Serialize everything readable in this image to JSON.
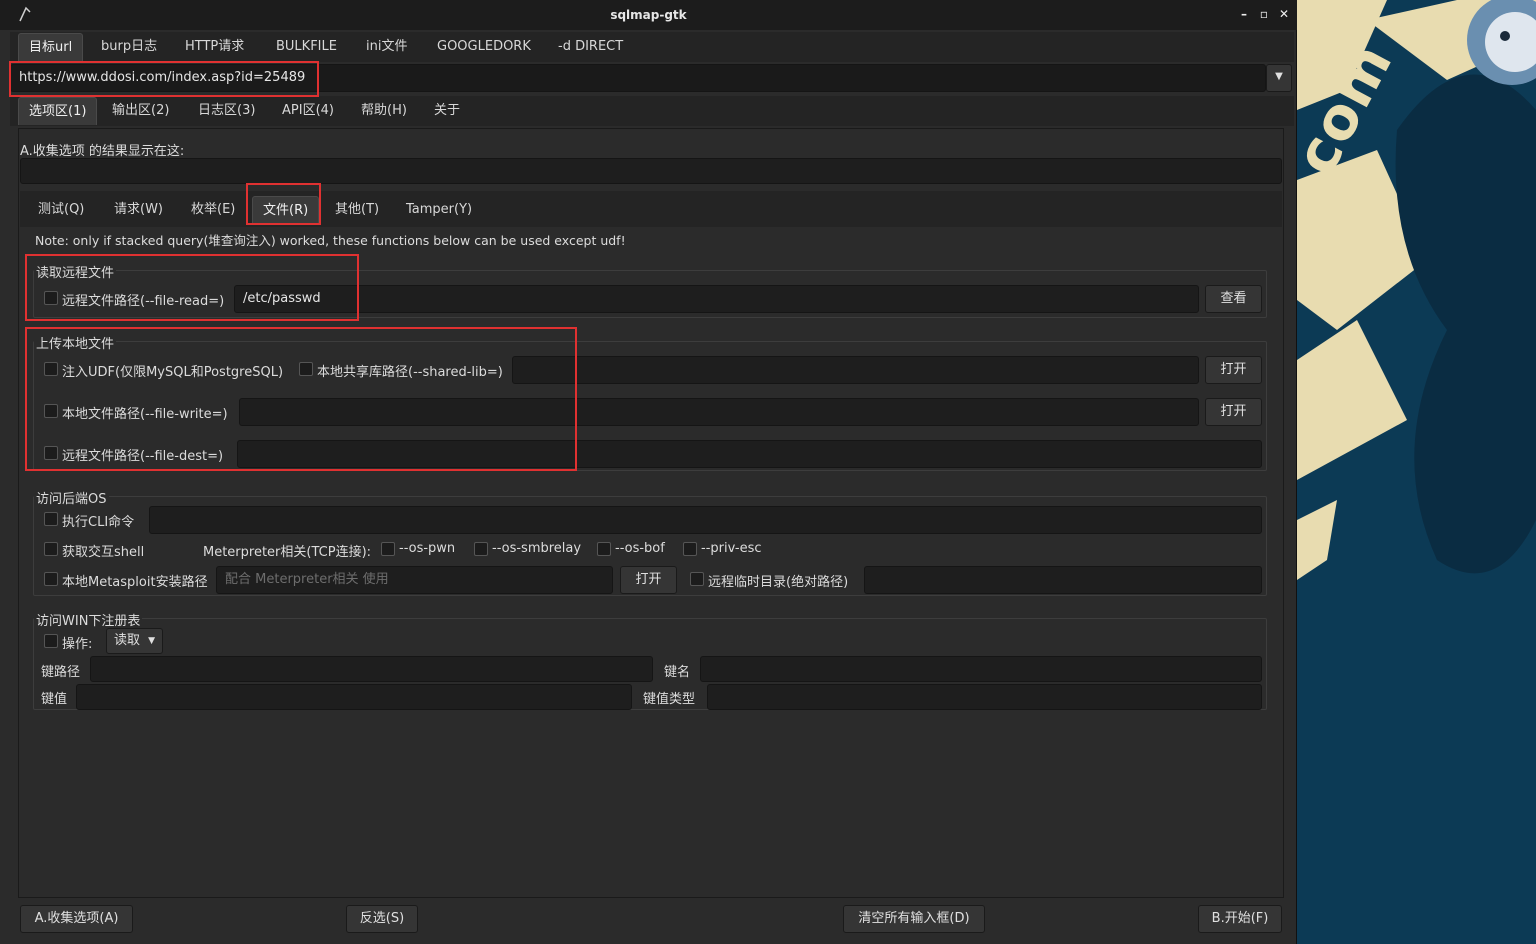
{
  "window": {
    "title": "sqlmap-gtk",
    "controls": [
      "–",
      "▫",
      "✕"
    ]
  },
  "top_tabs": [
    "目标url",
    "burp日志",
    "HTTP请求",
    "BULKFILE",
    "ini文件",
    "GOOGLEDORK",
    "-d DIRECT"
  ],
  "url_input": {
    "value": "https://www.ddosi.com/index.asp?id=25489"
  },
  "main_tabs": [
    "选项区(1)",
    "输出区(2)",
    "日志区(3)",
    "API区(4)",
    "帮助(H)",
    "关于"
  ],
  "collect": {
    "label": "A.收集选项 的结果显示在这:",
    "value": ""
  },
  "sub_tabs": [
    "测试(Q)",
    "请求(W)",
    "枚举(E)",
    "文件(R)",
    "其他(T)",
    "Tamper(Y)"
  ],
  "note": "Note: only if stacked query(堆查询注入) worked, these functions below can be used except udf!",
  "read_remote": {
    "title": "读取远程文件",
    "path_label": "远程文件路径(--file-read=)",
    "path_value": "/etc/passwd",
    "view_button": "查看"
  },
  "upload_local": {
    "title": "上传本地文件",
    "udf_label": "注入UDF(仅限MySQL和PostgreSQL)",
    "shared_lib_label": "本地共享库路径(--shared-lib=)",
    "open_button": "打开",
    "file_write_label": "本地文件路径(--file-write=)",
    "file_dest_label": "远程文件路径(--file-dest=)"
  },
  "os_access": {
    "title": "访问后端OS",
    "cli_label": "执行CLI命令",
    "shell_label": "获取交互shell",
    "meterpreter_label": "Meterpreter相关(TCP连接):",
    "os_pwn": "--os-pwn",
    "os_smbrelay": "--os-smbrelay",
    "os_bof": "--os-bof",
    "priv_esc": "--priv-esc",
    "msf_label": "本地Metasploit安装路径",
    "msf_placeholder": "配合 Meterpreter相关 使用",
    "open_button": "打开",
    "tmp_dir_label": "远程临时目录(绝对路径)"
  },
  "registry": {
    "title": "访问WIN下注册表",
    "op_label": "操作:",
    "op_value": "读取",
    "key_path_label": "键路径",
    "key_name_label": "键名",
    "key_value_label": "键值",
    "value_type_label": "键值类型"
  },
  "bottom": {
    "collect_button": "A.收集选项(A)",
    "invert_button": "反选(S)",
    "clear_button": "清空所有输入框(D)",
    "start_button": "B.开始(F)"
  },
  "wallpaper": {
    "text": "w.ddosi.com"
  },
  "colors": {
    "highlight": "#e03131",
    "window_bg": "#2b2b2b",
    "desktop_bg": "#0c3a55",
    "wallpaper_accent": "#e8dcb0"
  }
}
